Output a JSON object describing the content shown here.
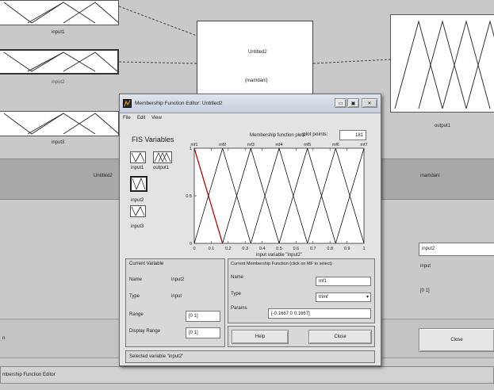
{
  "background": {
    "inputs": [
      {
        "label": "input1"
      },
      {
        "label": "input2"
      },
      {
        "label": "input3"
      }
    ],
    "system_box": {
      "name": "Untitled2",
      "type": "(mamdani)"
    },
    "output": {
      "label": "output1"
    },
    "band": {
      "left_text": "Untitled2",
      "right_text": "mamdani"
    },
    "right_panel": {
      "current_name": "input2",
      "type_text": "input",
      "range_text": "[0 1]"
    },
    "close_label": "Close",
    "left_edge_text": "n",
    "status_text": "mbership Function Editor"
  },
  "editor": {
    "title": "Membership Function Editor: Untitled2",
    "menu": [
      "File",
      "Edit",
      "View"
    ],
    "fis_variables_label": "FIS Variables",
    "variables": [
      {
        "label": "input1"
      },
      {
        "label": "output1"
      },
      {
        "label": "input2"
      },
      {
        "label": "input3"
      }
    ],
    "plot_header": "Membership function plots",
    "plot_points_label": "plot points:",
    "plot_points_value": "181",
    "current_variable": {
      "header": "Current Variable",
      "name_label": "Name",
      "name_value": "input2",
      "type_label": "Type",
      "type_value": "input",
      "range_label": "Range",
      "range_value": "[0 1]",
      "display_range_label": "Display Range",
      "display_range_value": "[0 1]"
    },
    "current_mf": {
      "header": "Current Membership Function (click on MF to select)",
      "name_label": "Name",
      "name_value": "mf1",
      "type_label": "Type",
      "type_value": "trimf",
      "params_label": "Params",
      "params_value": "[-0.1667 0 0.1667]"
    },
    "help_label": "Help",
    "close_label": "Close",
    "status_text": "Selected variable \"input2\""
  },
  "chart_data": {
    "type": "line",
    "xlabel": "input variable \"input2\"",
    "xlim": [
      0,
      1
    ],
    "ylim": [
      0,
      1
    ],
    "x_ticks": [
      "0",
      "0.1",
      "0.2",
      "0.3",
      "0.4",
      "0.5",
      "0.6",
      "0.7",
      "0.8",
      "0.9",
      "1"
    ],
    "y_ticks": [
      "0",
      "0.5",
      "1"
    ],
    "series": [
      {
        "name": "mf1",
        "points": [
          [
            -0.1667,
            0
          ],
          [
            0,
            1
          ],
          [
            0.1667,
            0
          ]
        ]
      },
      {
        "name": "mf2",
        "points": [
          [
            0,
            0
          ],
          [
            0.1667,
            1
          ],
          [
            0.3333,
            0
          ]
        ]
      },
      {
        "name": "mf3",
        "points": [
          [
            0.1667,
            0
          ],
          [
            0.3333,
            1
          ],
          [
            0.5,
            0
          ]
        ]
      },
      {
        "name": "mf4",
        "points": [
          [
            0.3333,
            0
          ],
          [
            0.5,
            1
          ],
          [
            0.6667,
            0
          ]
        ]
      },
      {
        "name": "mf5",
        "points": [
          [
            0.5,
            0
          ],
          [
            0.6667,
            1
          ],
          [
            0.8333,
            0
          ]
        ]
      },
      {
        "name": "mf6",
        "points": [
          [
            0.6667,
            0
          ],
          [
            0.8333,
            1
          ],
          [
            1,
            0
          ]
        ]
      },
      {
        "name": "mf7",
        "points": [
          [
            0.8333,
            0
          ],
          [
            1,
            1
          ],
          [
            1.1667,
            0
          ]
        ]
      }
    ],
    "selected": "mf1",
    "colors": {
      "line": "#111111",
      "selected": "#c00000"
    }
  }
}
